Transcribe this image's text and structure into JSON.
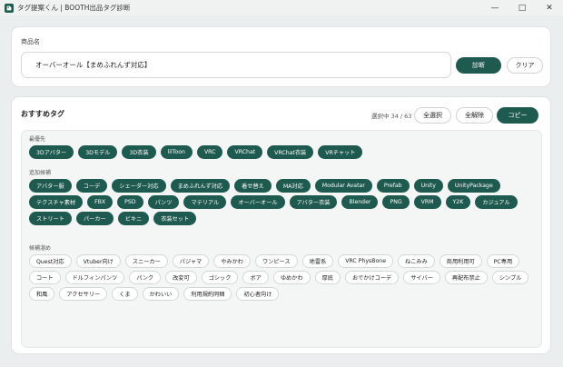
{
  "window": {
    "title": "タグ提案くん | BOOTH出品タグ診断",
    "controls": {
      "minimize": "—",
      "maximize": "□",
      "close": "✕"
    }
  },
  "product": {
    "label": "商品名",
    "value": "オーバーオール【まめふれんず対応】",
    "diagnose_label": "診断",
    "clear_label": "クリア"
  },
  "tags": {
    "title": "おすすめタグ",
    "selection_count": "選択中 34 / 63",
    "select_all_label": "全選択",
    "deselect_all_label": "全解除",
    "copy_label": "コピー",
    "sections": [
      {
        "label": "最優先",
        "chips": [
          {
            "text": "3Dアバター",
            "selected": true
          },
          {
            "text": "3Dモデル",
            "selected": true
          },
          {
            "text": "3D衣装",
            "selected": true
          },
          {
            "text": "lilToon",
            "selected": true
          },
          {
            "text": "VRC",
            "selected": true
          },
          {
            "text": "VRChat",
            "selected": true
          },
          {
            "text": "VRChat衣装",
            "selected": true
          },
          {
            "text": "VRチャット",
            "selected": true
          }
        ]
      },
      {
        "label": "追加候補",
        "chips": [
          {
            "text": "アバター服",
            "selected": true
          },
          {
            "text": "コーデ",
            "selected": true
          },
          {
            "text": "シェーダー対応",
            "selected": true
          },
          {
            "text": "まめふれんず対応",
            "selected": true
          },
          {
            "text": "着せ替え",
            "selected": true
          },
          {
            "text": "MA対応",
            "selected": true
          },
          {
            "text": "Modular Avatar",
            "selected": true
          },
          {
            "text": "Prefab",
            "selected": true
          },
          {
            "text": "Unity",
            "selected": true
          },
          {
            "text": "UnityPackage",
            "selected": true
          },
          {
            "text": "テクスチャ素材",
            "selected": true
          },
          {
            "text": "FBX",
            "selected": true
          },
          {
            "text": "PSD",
            "selected": true
          },
          {
            "text": "パンツ",
            "selected": true
          },
          {
            "text": "マテリアル",
            "selected": true
          },
          {
            "text": "オーバーオール",
            "selected": true
          },
          {
            "text": "アバター衣装",
            "selected": true
          },
          {
            "text": "Blender",
            "selected": true
          },
          {
            "text": "PNG",
            "selected": true
          },
          {
            "text": "VRM",
            "selected": true
          },
          {
            "text": "Y2K",
            "selected": true
          },
          {
            "text": "カジュアル",
            "selected": true
          },
          {
            "text": "ストリート",
            "selected": true
          },
          {
            "text": "パーカー",
            "selected": true
          },
          {
            "text": "ビキニ",
            "selected": true
          },
          {
            "text": "衣装セット",
            "selected": true
          }
        ]
      },
      {
        "label": "候補溜め",
        "chips": [
          {
            "text": "Quest対応",
            "selected": false
          },
          {
            "text": "Vtuber向け",
            "selected": false
          },
          {
            "text": "スニーカー",
            "selected": false
          },
          {
            "text": "パジャマ",
            "selected": false
          },
          {
            "text": "やみかわ",
            "selected": false
          },
          {
            "text": "ワンピース",
            "selected": false
          },
          {
            "text": "地雷系",
            "selected": false
          },
          {
            "text": "VRC PhysBone",
            "selected": false
          },
          {
            "text": "ねこみみ",
            "selected": false
          },
          {
            "text": "商用利用可",
            "selected": false
          },
          {
            "text": "PC専用",
            "selected": false
          },
          {
            "text": "コート",
            "selected": false
          },
          {
            "text": "ドルフィンパンツ",
            "selected": false
          },
          {
            "text": "パンク",
            "selected": false
          },
          {
            "text": "改変可",
            "selected": false
          },
          {
            "text": "ゴシック",
            "selected": false
          },
          {
            "text": "ボア",
            "selected": false
          },
          {
            "text": "ゆめかわ",
            "selected": false
          },
          {
            "text": "厚底",
            "selected": false
          },
          {
            "text": "おでかけコーデ",
            "selected": false
          },
          {
            "text": "サイバー",
            "selected": false
          },
          {
            "text": "再配布禁止",
            "selected": false
          },
          {
            "text": "シンプル",
            "selected": false
          },
          {
            "text": "和風",
            "selected": false
          },
          {
            "text": "アクセサリー",
            "selected": false
          },
          {
            "text": "くま",
            "selected": false
          },
          {
            "text": "かわいい",
            "selected": false
          },
          {
            "text": "利用規約同梱",
            "selected": false
          },
          {
            "text": "初心者向け",
            "selected": false
          }
        ]
      }
    ]
  },
  "colors": {
    "accent": "#1e5a50",
    "background": "#ebeeee",
    "card": "#ffffff"
  }
}
